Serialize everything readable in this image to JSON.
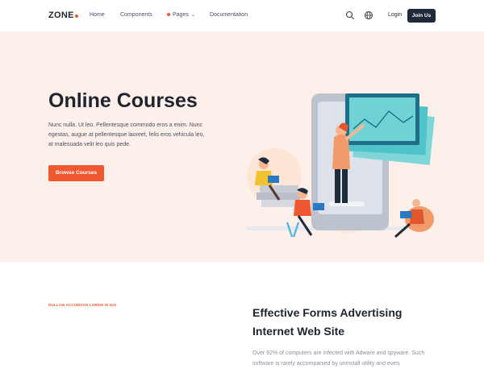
{
  "brand": {
    "name": "ZONE",
    "accent": "#f0582f",
    "dark": "#1f2a3a"
  },
  "nav": {
    "items": [
      {
        "label": "Home"
      },
      {
        "label": "Components"
      },
      {
        "label": "Pages"
      },
      {
        "label": "Documentation"
      }
    ],
    "icons": [
      "search-icon",
      "globe-icon"
    ],
    "login_label": "Login",
    "join_label": "Join Us"
  },
  "hero": {
    "title": "Online Courses",
    "description": "Nunc nulla. Ut leo. Pellentesque commodo eros a enim. Nunc egestas, augue at pellentesque laoreet, felis eros vehicula leo, at malesuada velit leo quis pede.",
    "button_label": "Browse Courses",
    "background": "#fdf0ea"
  },
  "section": {
    "eyebrow": "NULLAM ACCUMSAN LOREM IN DUI",
    "title": "Effective Forms Advertising Internet Web Site",
    "body": "Over 92% of computers are infected with Adware and spyware. Such software is rarely accompanied by uninstall utility and even"
  }
}
